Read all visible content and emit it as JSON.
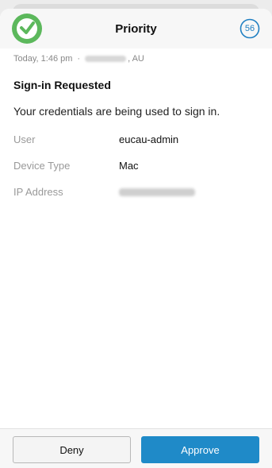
{
  "header": {
    "title": "Priority",
    "timer_value": "56",
    "logo_icon": "duo-logo-icon",
    "timer_icon": "countdown-ring-icon"
  },
  "meta": {
    "time": "Today, 1:46 pm",
    "separator": "·",
    "location_suffix": ", AU"
  },
  "request": {
    "heading": "Sign-in Requested",
    "message": "Your credentials are being used to sign in."
  },
  "details": [
    {
      "label": "User",
      "value": "eucau-admin"
    },
    {
      "label": "Device Type",
      "value": "Mac"
    },
    {
      "label": "IP Address",
      "value": ""
    }
  ],
  "actions": {
    "deny_label": "Deny",
    "approve_label": "Approve"
  },
  "colors": {
    "accent": "#1f8ac8",
    "logo_green": "#5cb85c"
  }
}
